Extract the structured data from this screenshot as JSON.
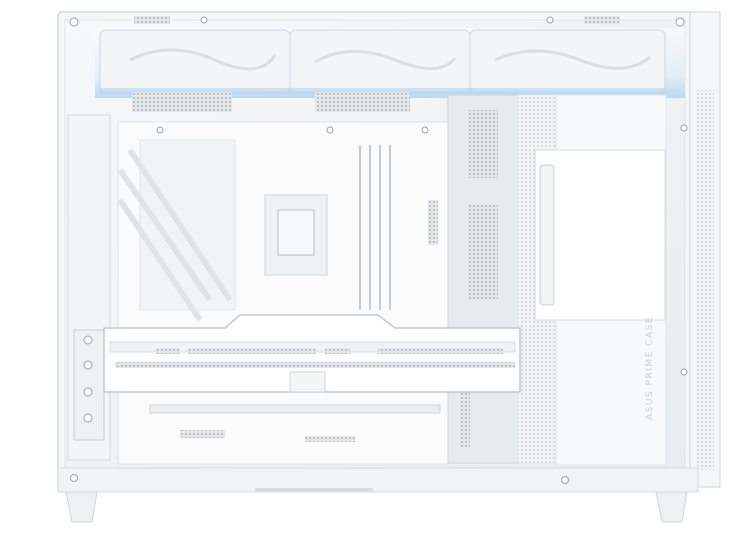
{
  "product": {
    "brand_label": "ASUS PRIME CASE"
  },
  "colors": {
    "background": "#ffffff",
    "frame": "#f4f5f6",
    "frame_edge": "#d6d9dc",
    "glass": "#eef0f2",
    "fan_glow": "#9cc8ef",
    "mesh": "#cfd3d7"
  },
  "components": {
    "top_fans": 3,
    "image_subject": "pc-case-side-view"
  }
}
